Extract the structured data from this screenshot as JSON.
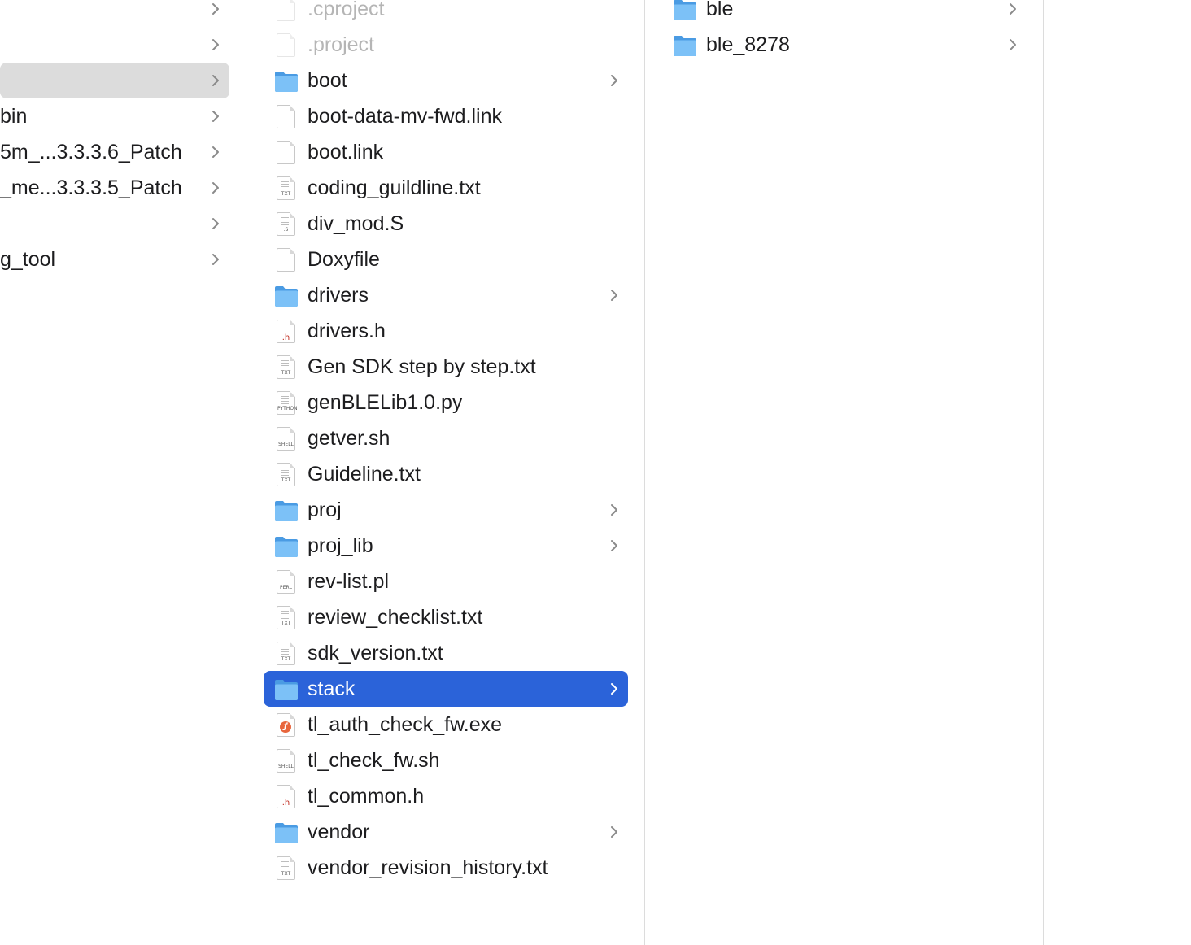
{
  "colors": {
    "selection_blue": "#2b63d9",
    "selection_gray": "#dcdcdc",
    "folder_blue": "#5aaef0",
    "divider": "#dcdcdc"
  },
  "column1": {
    "items": [
      {
        "label": "",
        "has_children": true
      },
      {
        "label": "",
        "has_children": true
      },
      {
        "label": "",
        "has_children": true,
        "selected": true
      },
      {
        "label": "bin",
        "has_children": true
      },
      {
        "label": "5m_...3.3.3.6_Patch",
        "has_children": true
      },
      {
        "label": "_me...3.3.3.5_Patch",
        "has_children": true
      },
      {
        "label": "",
        "has_children": true
      },
      {
        "label": "g_tool",
        "has_children": true
      }
    ]
  },
  "column2": {
    "items": [
      {
        "label": ".cproject",
        "icon": "generic-file-icon",
        "dimmed": true
      },
      {
        "label": ".project",
        "icon": "generic-file-icon",
        "dimmed": true
      },
      {
        "label": "boot",
        "icon": "folder-icon",
        "has_children": true
      },
      {
        "label": "boot-data-mv-fwd.link",
        "icon": "generic-file-icon"
      },
      {
        "label": "boot.link",
        "icon": "generic-file-icon"
      },
      {
        "label": "coding_guildline.txt",
        "icon": "text-file-icon",
        "tag": "TXT"
      },
      {
        "label": "div_mod.S",
        "icon": "assembly-file-icon",
        "tag": ".S"
      },
      {
        "label": "Doxyfile",
        "icon": "generic-file-icon"
      },
      {
        "label": "drivers",
        "icon": "folder-icon",
        "has_children": true
      },
      {
        "label": "drivers.h",
        "icon": "header-file-icon",
        "tag": ".h"
      },
      {
        "label": "Gen SDK step by step.txt",
        "icon": "text-file-icon",
        "tag": "TXT"
      },
      {
        "label": "genBLELib1.0.py",
        "icon": "python-file-icon",
        "tag": "PYTHON"
      },
      {
        "label": "getver.sh",
        "icon": "shell-script-icon",
        "tag": "SHELL"
      },
      {
        "label": "Guideline.txt",
        "icon": "text-file-icon",
        "tag": "TXT"
      },
      {
        "label": "proj",
        "icon": "folder-icon",
        "has_children": true
      },
      {
        "label": "proj_lib",
        "icon": "folder-icon",
        "has_children": true
      },
      {
        "label": "rev-list.pl",
        "icon": "perl-file-icon",
        "tag": "PERL"
      },
      {
        "label": "review_checklist.txt",
        "icon": "text-file-icon",
        "tag": "TXT"
      },
      {
        "label": "sdk_version.txt",
        "icon": "text-file-icon",
        "tag": "TXT"
      },
      {
        "label": "stack",
        "icon": "folder-icon",
        "has_children": true,
        "selected": true
      },
      {
        "label": "tl_auth_check_fw.exe",
        "icon": "executable-icon"
      },
      {
        "label": "tl_check_fw.sh",
        "icon": "shell-script-icon",
        "tag": "SHELL"
      },
      {
        "label": "tl_common.h",
        "icon": "header-file-icon",
        "tag": ".h"
      },
      {
        "label": "vendor",
        "icon": "folder-icon",
        "has_children": true
      },
      {
        "label": "vendor_revision_history.txt",
        "icon": "text-file-icon",
        "tag": "TXT"
      }
    ]
  },
  "column3": {
    "items": [
      {
        "label": "ble",
        "icon": "folder-icon",
        "has_children": true
      },
      {
        "label": "ble_8278",
        "icon": "folder-icon",
        "has_children": true
      }
    ]
  }
}
